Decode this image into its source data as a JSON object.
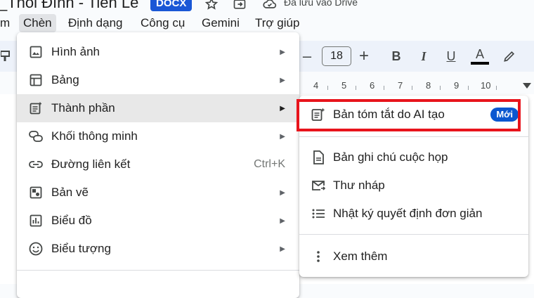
{
  "title_bar": {
    "doc_title": "_Thôi Đình - Tiến Lê",
    "file_badge": "DOCX",
    "saved_status": "Đã lưu vào Drive"
  },
  "menubar": {
    "items": [
      "m",
      "Chèn",
      "Định dạng",
      "Công cụ",
      "Gemini",
      "Trợ giúp"
    ],
    "active": "Chèn"
  },
  "toolbar": {
    "font_size": "18",
    "bold": "B",
    "italic": "I",
    "underline": "U",
    "text_color_letter": "A",
    "minus": "–",
    "plus": "+"
  },
  "ruler": {
    "numbers": [
      "4",
      "5",
      "6",
      "7",
      "8",
      "9",
      "10"
    ]
  },
  "insert_menu": {
    "items": [
      {
        "label": "Hình ảnh",
        "icon": "image-icon",
        "has_submenu": true
      },
      {
        "label": "Bảng",
        "icon": "table-icon",
        "has_submenu": true
      },
      {
        "label": "Thành phần",
        "icon": "building-blocks-icon",
        "has_submenu": true,
        "highlighted": true
      },
      {
        "label": "Khối thông minh",
        "icon": "smart-chip-icon",
        "has_submenu": true
      },
      {
        "label": "Đường liên kết",
        "icon": "link-icon",
        "shortcut": "Ctrl+K"
      },
      {
        "label": "Bản vẽ",
        "icon": "drawing-icon",
        "has_submenu": true
      },
      {
        "label": "Biểu đồ",
        "icon": "chart-icon",
        "has_submenu": true
      },
      {
        "label": "Biểu tượng",
        "icon": "emoji-icon",
        "has_submenu": true
      }
    ]
  },
  "building_blocks_submenu": {
    "items": [
      {
        "label": "Bản tóm tắt do AI tạo",
        "icon": "ai-summary-icon",
        "badge": "Mới"
      },
      {
        "label": "Bản ghi chú cuộc họp",
        "icon": "document-icon"
      },
      {
        "label": "Thư nháp",
        "icon": "email-draft-icon"
      },
      {
        "label": "Nhật ký quyết định đơn giản",
        "icon": "list-icon"
      },
      {
        "label": "Xem thêm",
        "icon": "more-vert-icon"
      }
    ]
  },
  "colors": {
    "accent": "#0b57d0",
    "highlight_border": "#e8141c",
    "menu_highlight": "#e8e8e8"
  }
}
